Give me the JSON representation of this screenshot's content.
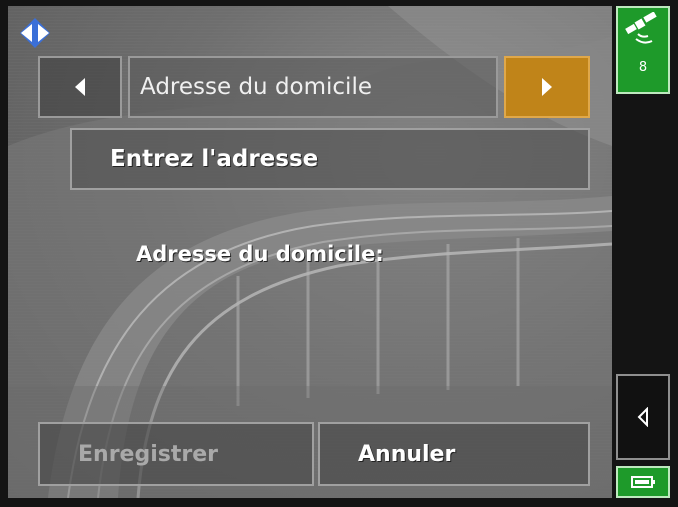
{
  "header": {
    "title": "Adresse du domicile",
    "prev_icon": "left-arrow-icon",
    "next_icon": "right-arrow-icon"
  },
  "main": {
    "enter_address_label": "Entrez l'adresse",
    "home_address_label": "Adresse du domicile:"
  },
  "footer": {
    "save_label": "Enregistrer",
    "cancel_label": "Annuler"
  },
  "sidebar": {
    "gps_satellites": "8",
    "gps_icon": "satellite-icon",
    "back_icon": "back-arrow-icon",
    "battery_icon": "battery-icon"
  },
  "colors": {
    "accent_orange": "#c08419",
    "status_green": "#1e9a2a"
  }
}
